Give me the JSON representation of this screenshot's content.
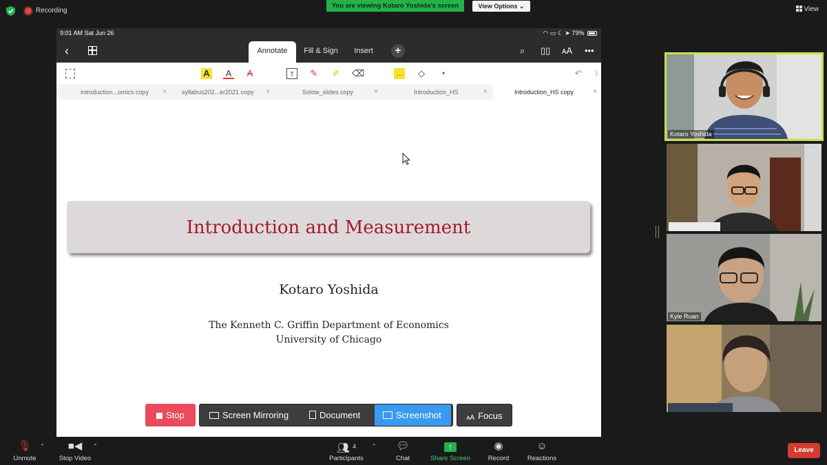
{
  "top": {
    "recording_label": "Recording",
    "viewing_banner": "You are viewing Kotaro Yoshida's screen",
    "view_options": "View Options ⌄",
    "view_label": "View"
  },
  "ipad": {
    "status_time": "9:01 AM   Sat Jun 26",
    "battery": "79%",
    "tabs": [
      {
        "label": "Annotate",
        "active": true
      },
      {
        "label": "Fill & Sign",
        "active": false
      },
      {
        "label": "Insert",
        "active": false
      }
    ],
    "doc_tabs": [
      {
        "label": "introduction...omics copy",
        "active": false
      },
      {
        "label": "syllabus202...er2021 copy",
        "active": false
      },
      {
        "label": "Solow_slides copy",
        "active": false
      },
      {
        "label": "Introduction_HS",
        "active": false
      },
      {
        "label": "Introduction_HS copy",
        "active": true
      }
    ],
    "slide": {
      "title": "Introduction and Measurement",
      "author": "Kotaro Yoshida",
      "affiliation_line1": "The Kenneth C. Griffin Department of Economics",
      "affiliation_line2": "University of Chicago"
    }
  },
  "controls": {
    "stop": "Stop",
    "screen_mirroring": "Screen Mirroring",
    "document": "Document",
    "screenshot": "Screenshot",
    "focus": "Focus"
  },
  "participants_video": [
    {
      "name": "Kotaro Yoshida",
      "active_speaker": true
    },
    {
      "name": "",
      "active_speaker": false
    },
    {
      "name": "Kyle Ruan",
      "active_speaker": false
    },
    {
      "name": "",
      "active_speaker": false
    }
  ],
  "bottom": {
    "unmute": "Unmute",
    "stop_video": "Stop Video",
    "participants": "Participants",
    "participants_count": "4",
    "chat": "Chat",
    "share_screen": "Share Screen",
    "record": "Record",
    "reactions": "Reactions",
    "leave": "Leave"
  },
  "colors": {
    "banner_green": "#23b24b",
    "speaker_border": "#c8e04a",
    "slide_title_red": "#a3192a",
    "leave_red": "#d23b33",
    "screenshot_blue": "#3a9af0"
  }
}
